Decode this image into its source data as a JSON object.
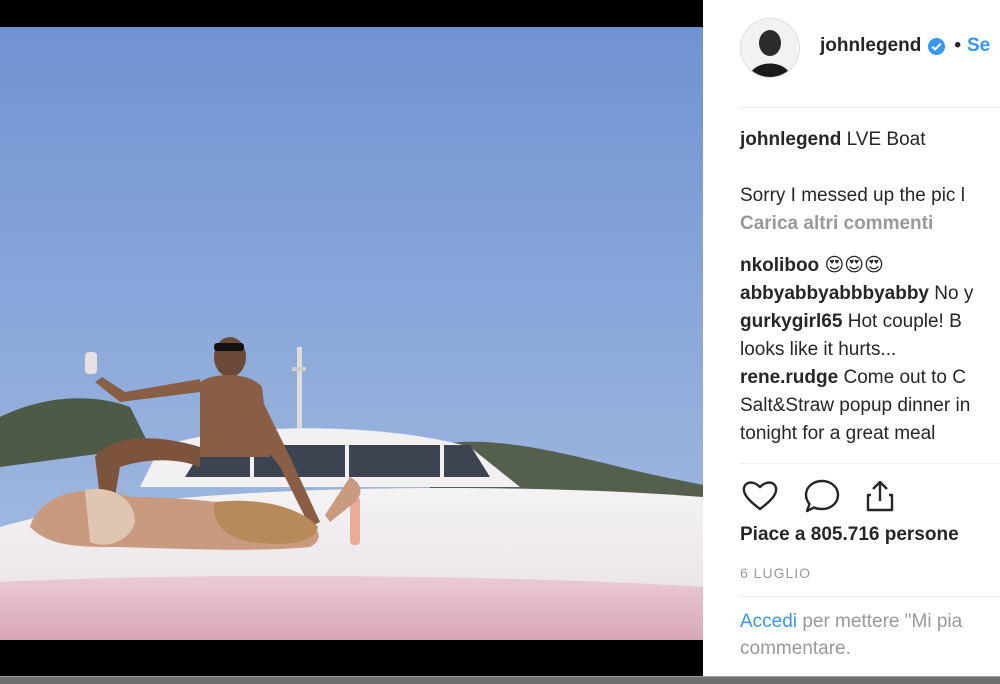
{
  "post": {
    "username": "johnlegend",
    "follow_label": "Se",
    "separator": "•",
    "caption": "LVE Boat",
    "caption_line2": "Sorry I messed up the pic l",
    "load_more": "Carica altri commenti",
    "comments": [
      {
        "user": "nkoliboo",
        "text": "😍😍😍"
      },
      {
        "user": "abbyabbyabbbyabby",
        "text": "No y"
      },
      {
        "user": "gurkygirl65",
        "text": "Hot couple! B"
      },
      {
        "user": "",
        "text": "looks like it hurts..."
      },
      {
        "user": "rene.rudge",
        "text": "Come out to C"
      },
      {
        "user": "",
        "text": "Salt&Straw popup dinner in"
      },
      {
        "user": "",
        "text": "tonight for a great meal"
      }
    ],
    "likes": "Piace a 805.716 persone",
    "date": "6 LUGLIO",
    "login_link": "Accedi",
    "login_text_1": "per mettere \"Mi pia",
    "login_text_2": "commentare."
  },
  "icons": {
    "verified": "verified-badge-icon",
    "like": "heart-icon",
    "comment": "comment-bubble-icon",
    "share": "share-icon"
  },
  "colors": {
    "link": "#3897f0",
    "muted": "#999999",
    "text": "#262626",
    "sky": "#7d9fd6"
  }
}
